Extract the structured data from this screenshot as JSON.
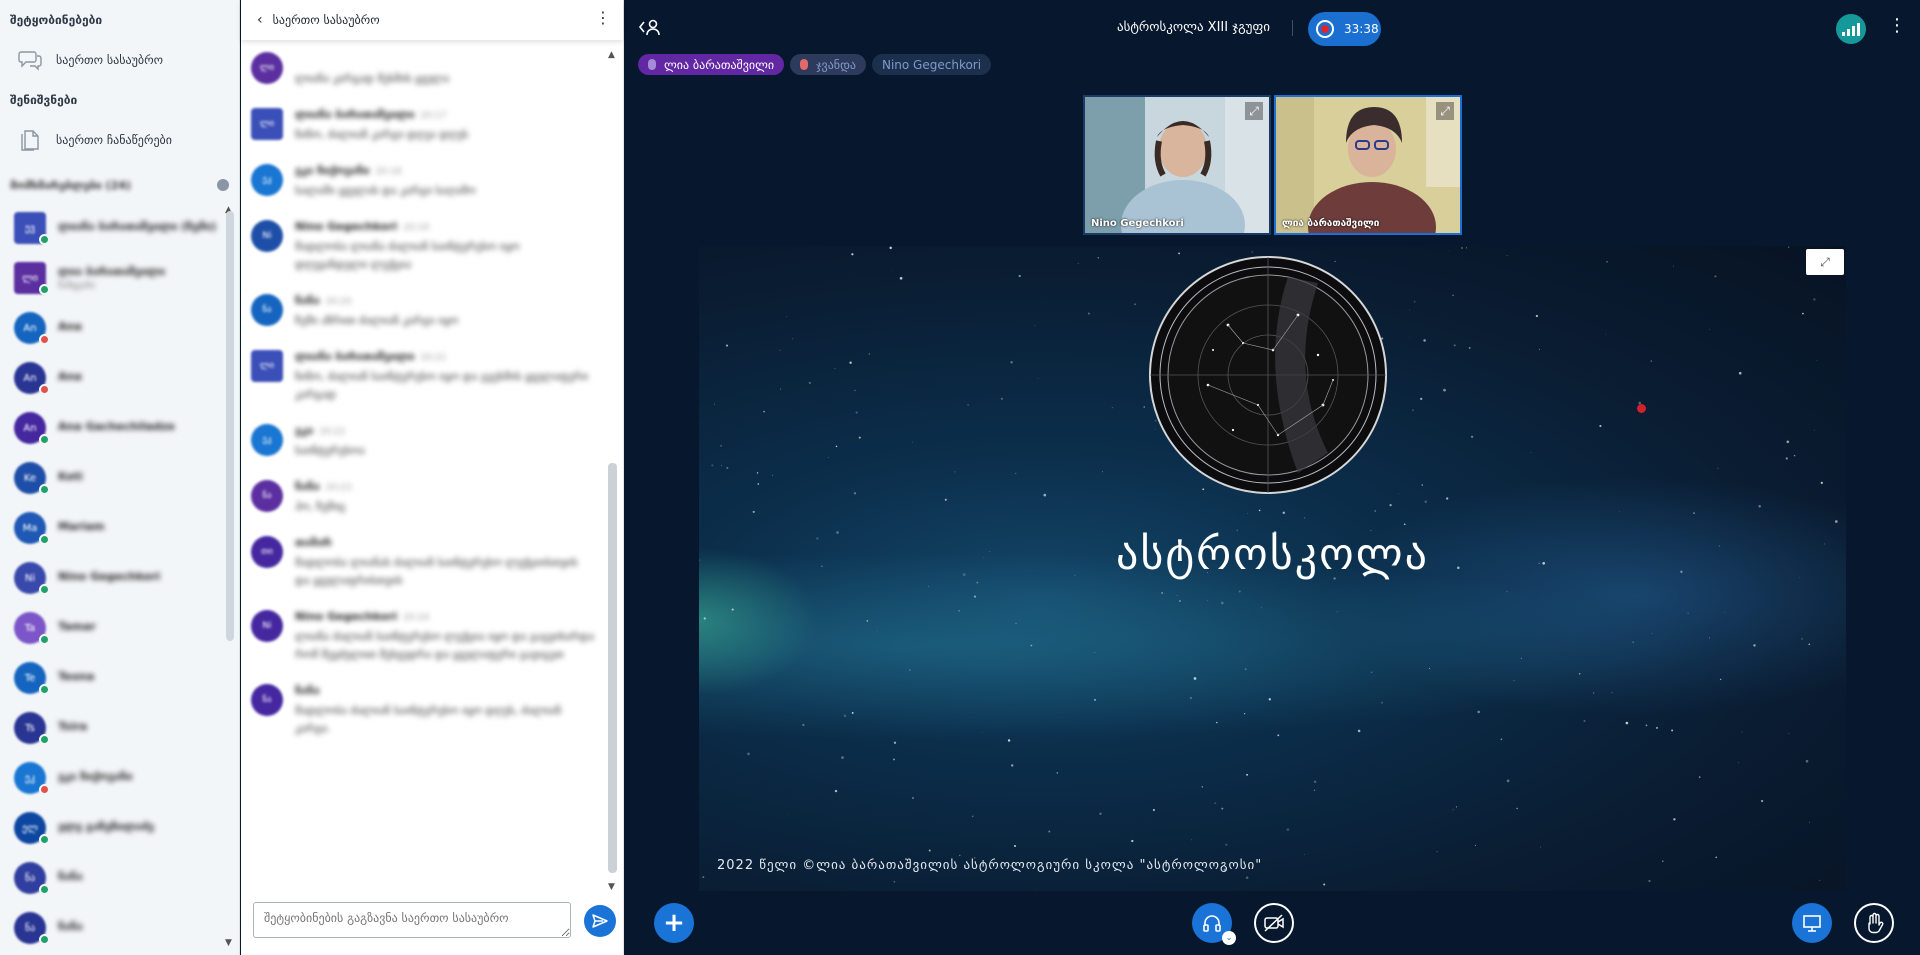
{
  "sidebar": {
    "messages_header": "შეტყობინებები",
    "public_chat": "საერთო სასაუბრო",
    "notes_header": "შენიშვნები",
    "shared_notes": "საერთო ჩანაწერები",
    "users_header": "მომხმარებლები (24)",
    "users": [
      {
        "initials": "ევ",
        "name": "ლიანა ბარათაშვილი (ჩემი)",
        "status": "",
        "color": "#3b4fb8",
        "shape": "square",
        "dot": "#21a16a"
      },
      {
        "initials": "ლი",
        "name": "ლია ბარათაშვილი",
        "status": "წამყვანი",
        "color": "#5b2fa0",
        "shape": "square",
        "dot": "#21a16a"
      },
      {
        "initials": "An",
        "name": "Ana",
        "status": "",
        "color": "#1565c0",
        "shape": "circle",
        "dot": "#e0534a"
      },
      {
        "initials": "An",
        "name": "Ana",
        "status": "",
        "color": "#283593",
        "shape": "circle",
        "dot": "#e0534a"
      },
      {
        "initials": "An",
        "name": "Ana Gachechiladze",
        "status": "",
        "color": "#4527a0",
        "shape": "circle",
        "dot": "#21a16a"
      },
      {
        "initials": "Ke",
        "name": "Keti",
        "status": "",
        "color": "#1e4fa8",
        "shape": "circle",
        "dot": "#21a16a"
      },
      {
        "initials": "Ma",
        "name": "Mariam",
        "status": "",
        "color": "#1f58b5",
        "shape": "circle",
        "dot": "#21a16a"
      },
      {
        "initials": "Ni",
        "name": "Nino Gegechkori",
        "status": "",
        "color": "#3949ab",
        "shape": "circle",
        "dot": "#21a16a"
      },
      {
        "initials": "Ta",
        "name": "Tamar",
        "status": "",
        "color": "#7c55c8",
        "shape": "circle",
        "dot": "#21a16a"
      },
      {
        "initials": "Te",
        "name": "Teona",
        "status": "",
        "color": "#1565c0",
        "shape": "circle",
        "dot": "#21a16a"
      },
      {
        "initials": "Ts",
        "name": "Tsira",
        "status": "",
        "color": "#283593",
        "shape": "circle",
        "dot": "#21a16a"
      },
      {
        "initials": "ეკ",
        "name": "ეკა ჩიქოვანი",
        "status": "",
        "color": "#1976d2",
        "shape": "circle",
        "dot": "#e0534a"
      },
      {
        "initials": "ელ",
        "name": "ელე გაჩეჩილაძე",
        "status": "",
        "color": "#0d47a1",
        "shape": "circle",
        "dot": "#21a16a"
      },
      {
        "initials": "ნა",
        "name": "ნანა",
        "status": "",
        "color": "#303f9f",
        "shape": "circle",
        "dot": "#21a16a"
      },
      {
        "initials": "ნა",
        "name": "ნანა",
        "status": "",
        "color": "#283593",
        "shape": "circle",
        "dot": "#21a16a"
      }
    ]
  },
  "chat": {
    "title": "საერთო სასაუბრო",
    "placeholder": "შეტყობინების გაგზავნა საერთო სასაუბრო",
    "messages": [
      {
        "initials": "ლი",
        "color": "#5b2fa0",
        "shape": "circle",
        "who": "",
        "time": "",
        "text": "ლიანა კარგად მესმის ყველა"
      },
      {
        "initials": "ლი",
        "color": "#3b4fb8",
        "shape": "square",
        "who": "ლიანა ბარათაშვილი",
        "time": "20:17",
        "text": "ნინო, ძალიან კარგი დღეა დღეს"
      },
      {
        "initials": "ეკ",
        "color": "#1976d2",
        "shape": "circle",
        "who": "ეკა ჩიქოვანი",
        "time": "20:18",
        "text": "სალამი ყველას და კარგი საღამო"
      },
      {
        "initials": "Ni",
        "color": "#1e4fa8",
        "shape": "circle",
        "who": "Nino Gegechkori",
        "time": "20:19",
        "text": "მადლობა ლიანა ძალიან საინტერესო იყო დღევანდელი ლექცია"
      },
      {
        "initials": "ნა",
        "color": "#1565c0",
        "shape": "circle",
        "who": "ნანა",
        "time": "20:20",
        "text": "ჩემი აზრით ძალიან კარგი იყო"
      },
      {
        "initials": "ლი",
        "color": "#3b4fb8",
        "shape": "square",
        "who": "ლიანა ბარათაშვილი",
        "time": "20:21",
        "text": "ნინო, ძალიან საინტერესო იყო და გვესმის ყველაფერი კარგად"
      },
      {
        "initials": "ეკ",
        "color": "#1976d2",
        "shape": "circle",
        "who": "ეკა",
        "time": "20:22",
        "text": "საინტერესოა"
      },
      {
        "initials": "ნა",
        "color": "#5b2fa0",
        "shape": "circle",
        "who": "ნანა",
        "time": "20:23",
        "text": "ჰო, ჩემიც"
      },
      {
        "initials": "თი",
        "color": "#4527a0",
        "shape": "circle",
        "who": "თამარ",
        "time": "",
        "text": "მადლობა ლიანას ძალიან საინტერესო ლექციისთვის და ყველაფრისთვის"
      },
      {
        "initials": "Ni",
        "color": "#4527a0",
        "shape": "circle",
        "who": "Nino Gegechkori",
        "time": "20:24",
        "text": "ლიანა ძალიან საინტერესო ლექცია იყო და გაგვიხარდა რომ შევძელით შეხვედრა და ყველაფერი გავიგეთ"
      },
      {
        "initials": "ნა",
        "color": "#4527a0",
        "shape": "circle",
        "who": "ნანა",
        "time": "",
        "text": "მადლობა ძალიან საინტერესო იყო დღეს, ძალიან კარგი."
      }
    ]
  },
  "meeting": {
    "room_title": "ასტროსკოლა XIII ჯგუფი",
    "recording_time": "33:38",
    "talkers": [
      "ლია ბარათაშვილი",
      "ჯვანდა",
      "Nino Gegechkori"
    ],
    "videos": [
      {
        "name": "Nino Gegechkori"
      },
      {
        "name": "ლია ბარათაშვილი"
      }
    ],
    "slide_title": "ასტროსკოლა",
    "slide_footer": "2022 წელი ©ლია ბარათაშვილის ასტროლოგიური სკოლა \"ასტროლოგოსი\""
  },
  "icons": {
    "chat": "chat-bubbles-icon",
    "notes": "document-icon",
    "users_gear": "gear-icon",
    "back": "chevron-left-icon",
    "menu": "kebab-menu-icon",
    "send": "send-icon",
    "user_list": "user-list-icon",
    "record": "record-icon",
    "connection": "signal-bars-icon",
    "options": "kebab-menu-icon",
    "fullscreen": "fullscreen-icon",
    "add": "plus-icon",
    "audio": "headphones-icon",
    "camera": "camera-off-icon",
    "presentation": "presentation-icon",
    "hand": "raise-hand-icon"
  },
  "colors": {
    "accent": "#1a73d6",
    "meeting_bg": "#06172e",
    "talking": "#6227a3",
    "connection": "#16989a"
  }
}
